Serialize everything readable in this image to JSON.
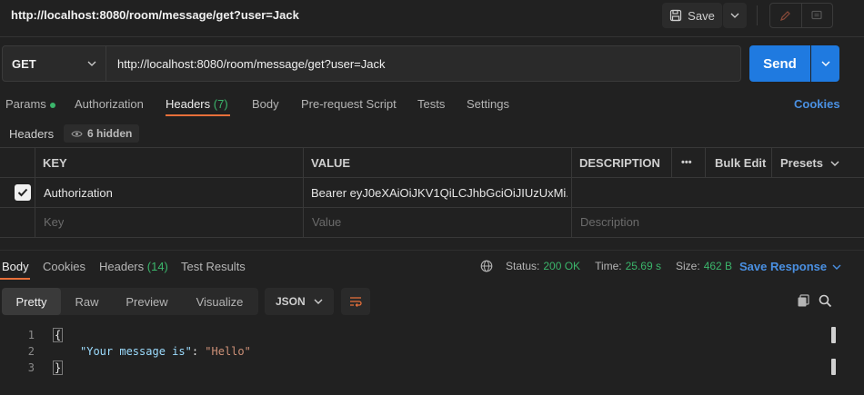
{
  "title": "http://localhost:8080/room/message/get?user=Jack",
  "toolbar": {
    "save_label": "Save"
  },
  "request": {
    "method": "GET",
    "url": "http://localhost:8080/room/message/get?user=Jack",
    "send_label": "Send"
  },
  "tabs": {
    "params": "Params",
    "authorization": "Authorization",
    "headers": "Headers",
    "headers_count": "(7)",
    "body": "Body",
    "prerequest": "Pre-request Script",
    "tests": "Tests",
    "settings": "Settings",
    "cookies": "Cookies"
  },
  "headers_section": {
    "label": "Headers",
    "hidden": "6 hidden"
  },
  "table": {
    "columns": {
      "key": "KEY",
      "value": "VALUE",
      "description": "DESCRIPTION",
      "more": "•••",
      "bulk_edit": "Bulk Edit",
      "presets": "Presets"
    },
    "rows": [
      {
        "key": "Authorization",
        "value": "Bearer eyJ0eXAiOiJKV1QiLCJhbGciOiJIUzUxMi...",
        "description": "",
        "checked": true
      }
    ],
    "placeholder": {
      "key": "Key",
      "value": "Value",
      "description": "Description"
    }
  },
  "response": {
    "tabs": {
      "body": "Body",
      "cookies": "Cookies",
      "headers": "Headers",
      "headers_count": "(14)",
      "test_results": "Test Results"
    },
    "status_label": "Status:",
    "status_value": "200 OK",
    "time_label": "Time:",
    "time_value": "25.69 s",
    "size_label": "Size:",
    "size_value": "462 B",
    "save_response": "Save Response",
    "views": {
      "pretty": "Pretty",
      "raw": "Raw",
      "preview": "Preview",
      "visualize": "Visualize"
    },
    "format": "JSON",
    "lines": [
      "1",
      "2",
      "3"
    ],
    "code": {
      "open": "{",
      "key": "\"Your message is\"",
      "colon": ": ",
      "value": "\"Hello\"",
      "close": "}"
    }
  },
  "colors": {
    "accent": "#1f7ae0",
    "tab_underline": "#e8703a",
    "success": "#3bb56b",
    "link": "#4a90e2"
  }
}
